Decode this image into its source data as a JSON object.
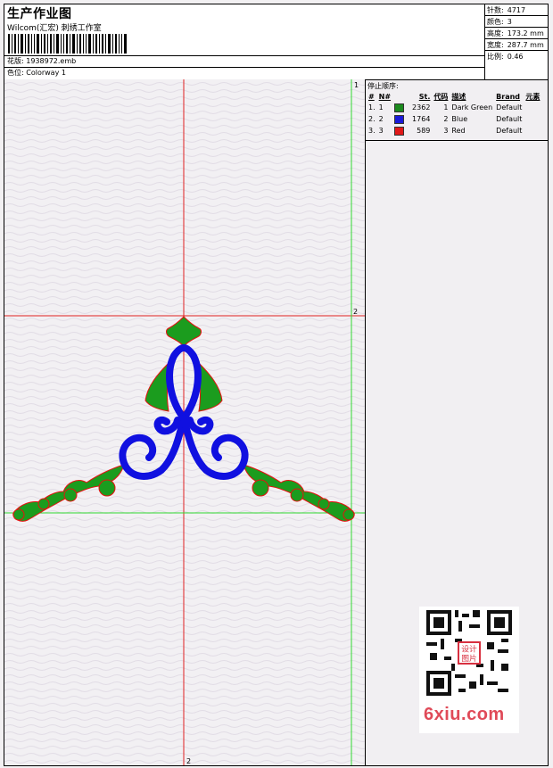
{
  "header": {
    "title": "生产作业图",
    "subtitle": "Wilcom(汇宏) 刺绣工作室",
    "file_label": "花版:",
    "file_value": "1938972.emb",
    "colorway_label": "色位:",
    "colorway_value": "Colorway 1"
  },
  "stats": [
    {
      "label": "针数:",
      "value": "4717"
    },
    {
      "label": "颜色:",
      "value": "3"
    },
    {
      "label": "高度:",
      "value": "173.2 mm"
    },
    {
      "label": "宽度:",
      "value": "287.7 mm"
    },
    {
      "label": "比例:",
      "value": "0.46"
    }
  ],
  "design": {
    "markers": {
      "top": "1",
      "right": "2",
      "bottom": "2"
    },
    "colors": {
      "green": "#1b9c1e",
      "blue": "#1010e0",
      "outline": "#e81010",
      "guide_red": "#e02020",
      "guide_green": "#30d830"
    }
  },
  "stop_panel": {
    "title": "停止顺序:",
    "headers": [
      "#",
      "N#",
      "St.",
      "代码",
      "描述",
      "Brand",
      "元素"
    ],
    "rows": [
      {
        "num": "1.",
        "n": "1",
        "swatch": "#1b8a1e",
        "stitches": "2362",
        "code": "1",
        "desc": "Dark Green",
        "brand": "Default"
      },
      {
        "num": "2.",
        "n": "2",
        "swatch": "#1a1ad8",
        "stitches": "1764",
        "code": "2",
        "desc": "Blue",
        "brand": "Default"
      },
      {
        "num": "3.",
        "n": "3",
        "swatch": "#e01818",
        "stitches": "589",
        "code": "3",
        "desc": "Red",
        "brand": "Default"
      }
    ]
  },
  "watermark": {
    "site": "6xiu.com",
    "stamp": "设计图片"
  }
}
